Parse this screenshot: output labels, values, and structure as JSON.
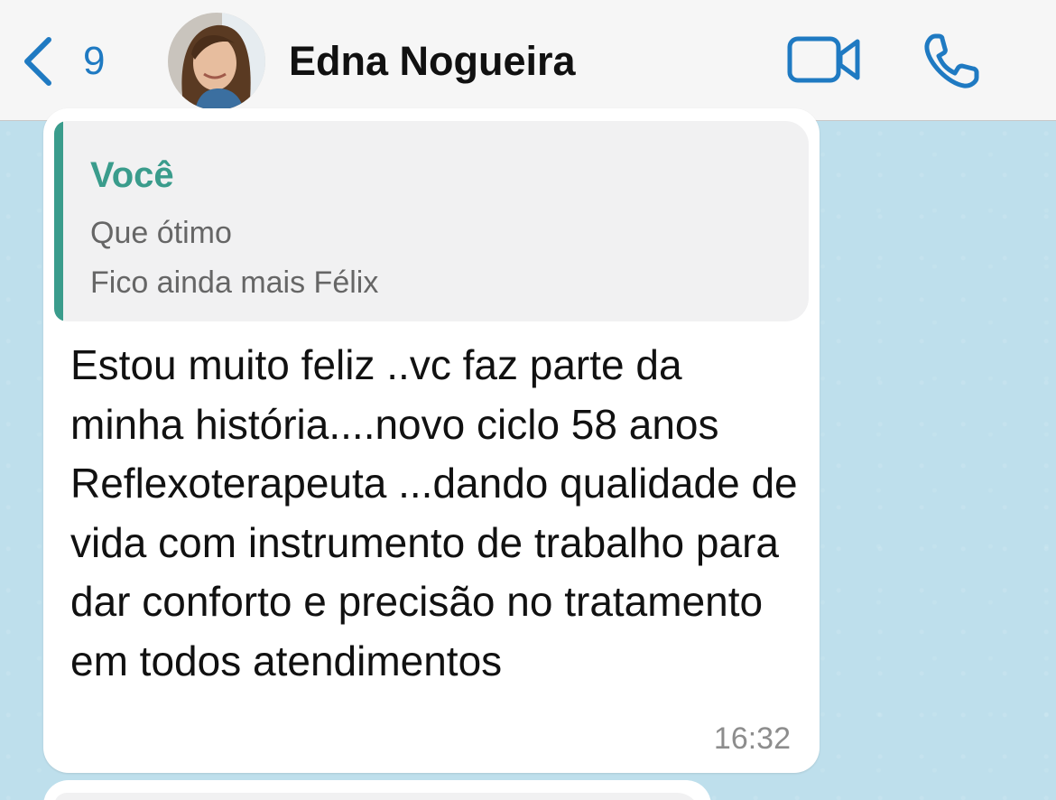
{
  "header": {
    "back_count": "9",
    "contact_name": "Edna Nogueira",
    "icons": {
      "back": "chevron-left-icon",
      "video": "video-camera-icon",
      "call": "phone-icon"
    },
    "accent_color": "#1f7ac2"
  },
  "message": {
    "quoted": {
      "author": "Você",
      "lines": [
        "Que ótimo",
        "Fico ainda mais Félix"
      ],
      "accent_color": "#3a9c8c"
    },
    "text": "Estou muito feliz ..vc faz parte da minha história....novo ciclo 58 anos Reflexoterapeuta ...dando qualidade de vida com instrumento de trabalho para dar conforto e precisão no tratamento em todos atendimentos",
    "time": "16:32"
  }
}
